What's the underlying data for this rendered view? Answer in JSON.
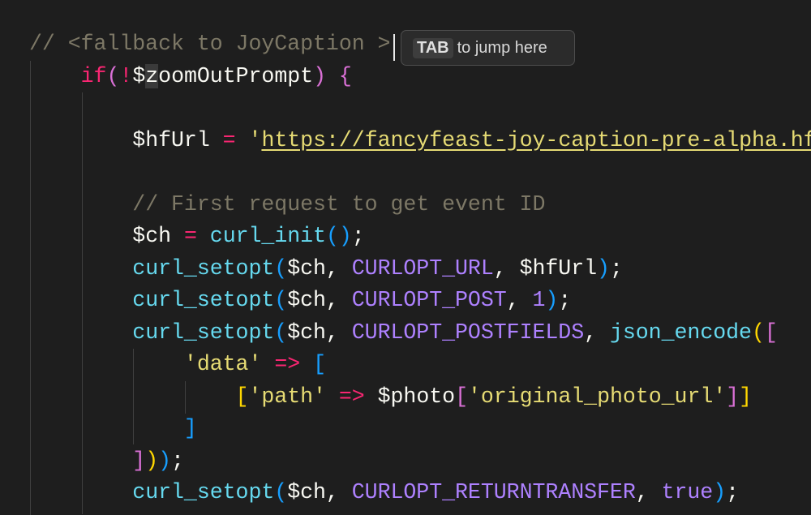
{
  "tooltip": {
    "key": "TAB",
    "text": "to jump here"
  },
  "lines": [
    [
      [
        "// <fallback to JoyCaption >",
        "comment"
      ]
    ],
    [
      [
        "    ",
        "plain"
      ],
      [
        "if",
        "kw"
      ],
      [
        "(",
        "b2"
      ],
      [
        "!",
        "op"
      ],
      [
        "$",
        "var"
      ],
      [
        "z",
        "var hl"
      ],
      [
        "oomOutPrompt",
        "var"
      ],
      [
        ")",
        "b2"
      ],
      [
        " ",
        "plain"
      ],
      [
        "{",
        "b2"
      ]
    ],
    [],
    [
      [
        "        ",
        "plain"
      ],
      [
        "$hfUrl",
        "var"
      ],
      [
        " ",
        "plain"
      ],
      [
        "=",
        "op"
      ],
      [
        " ",
        "plain"
      ],
      [
        "'",
        "str"
      ],
      [
        "https://fancyfeast-joy-caption-pre-alpha.hf",
        "url"
      ]
    ],
    [],
    [
      [
        "        ",
        "plain"
      ],
      [
        "// First request to get event ID",
        "comment"
      ]
    ],
    [
      [
        "        ",
        "plain"
      ],
      [
        "$ch",
        "var"
      ],
      [
        " ",
        "plain"
      ],
      [
        "=",
        "op"
      ],
      [
        " ",
        "plain"
      ],
      [
        "curl_init",
        "fn"
      ],
      [
        "()",
        "b3"
      ],
      [
        ";",
        "plain"
      ]
    ],
    [
      [
        "        ",
        "plain"
      ],
      [
        "curl_setopt",
        "fn"
      ],
      [
        "(",
        "b3"
      ],
      [
        "$ch, ",
        "var"
      ],
      [
        "CURLOPT_URL",
        "const"
      ],
      [
        ", ",
        "plain"
      ],
      [
        "$hfUrl",
        "var"
      ],
      [
        ")",
        "b3"
      ],
      [
        ";",
        "plain"
      ]
    ],
    [
      [
        "        ",
        "plain"
      ],
      [
        "curl_setopt",
        "fn"
      ],
      [
        "(",
        "b3"
      ],
      [
        "$ch, ",
        "var"
      ],
      [
        "CURLOPT_POST",
        "const"
      ],
      [
        ", ",
        "plain"
      ],
      [
        "1",
        "num"
      ],
      [
        ")",
        "b3"
      ],
      [
        ";",
        "plain"
      ]
    ],
    [
      [
        "        ",
        "plain"
      ],
      [
        "curl_setopt",
        "fn"
      ],
      [
        "(",
        "b3"
      ],
      [
        "$ch, ",
        "var"
      ],
      [
        "CURLOPT_POSTFIELDS",
        "const"
      ],
      [
        ", ",
        "plain"
      ],
      [
        "json_encode",
        "fn"
      ],
      [
        "(",
        "b1"
      ],
      [
        "[",
        "b2"
      ]
    ],
    [
      [
        "            ",
        "plain"
      ],
      [
        "'data'",
        "str"
      ],
      [
        " ",
        "plain"
      ],
      [
        "=>",
        "op"
      ],
      [
        " ",
        "plain"
      ],
      [
        "[",
        "b3"
      ]
    ],
    [
      [
        "                ",
        "plain"
      ],
      [
        "[",
        "b1"
      ],
      [
        "'path'",
        "str"
      ],
      [
        " ",
        "plain"
      ],
      [
        "=>",
        "op"
      ],
      [
        " ",
        "plain"
      ],
      [
        "$photo",
        "var"
      ],
      [
        "[",
        "b2"
      ],
      [
        "'original_photo_url'",
        "str"
      ],
      [
        "]",
        "b2"
      ],
      [
        "]",
        "b1"
      ]
    ],
    [
      [
        "            ",
        "plain"
      ],
      [
        "]",
        "b3"
      ]
    ],
    [
      [
        "        ",
        "plain"
      ],
      [
        "]",
        "b2"
      ],
      [
        ")",
        "b1"
      ],
      [
        ")",
        "b3"
      ],
      [
        ";",
        "plain"
      ]
    ],
    [
      [
        "        ",
        "plain"
      ],
      [
        "curl_setopt",
        "fn"
      ],
      [
        "(",
        "b3"
      ],
      [
        "$ch, ",
        "var"
      ],
      [
        "CURLOPT_RETURNTRANSFER",
        "const"
      ],
      [
        ", ",
        "plain"
      ],
      [
        "true",
        "num"
      ],
      [
        ")",
        "b3"
      ],
      [
        ";",
        "plain"
      ]
    ]
  ]
}
